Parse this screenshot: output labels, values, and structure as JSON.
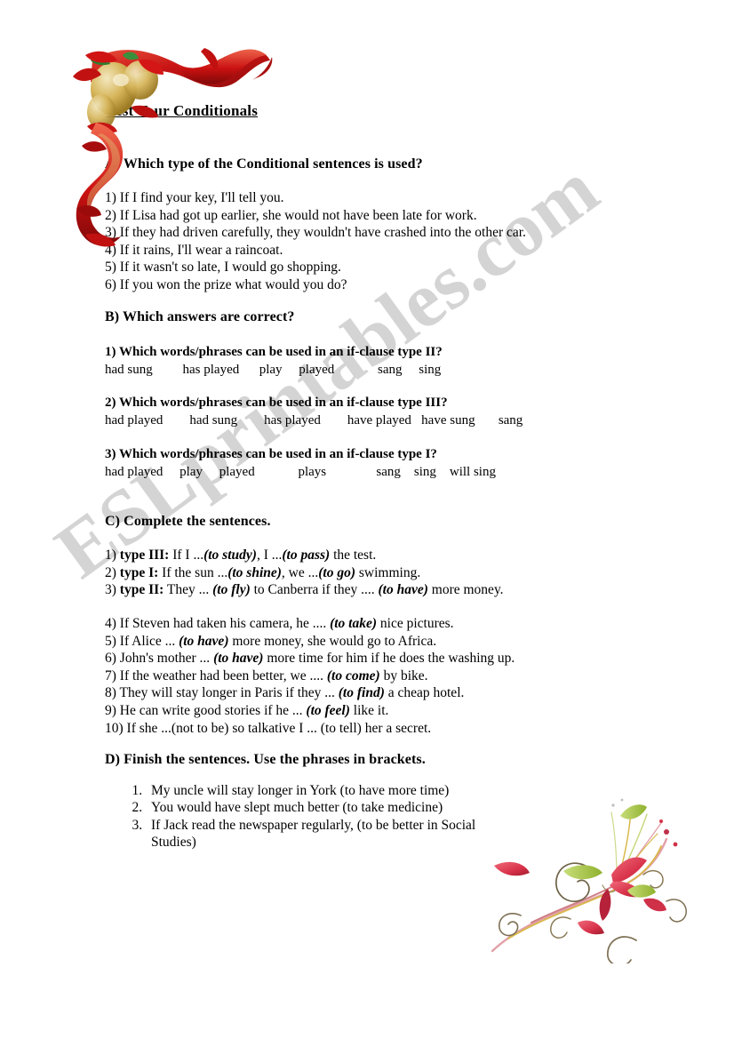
{
  "document": {
    "title": "Test Your Conditionals",
    "watermark": "ESLprintables.com",
    "watermark_color": "#d2d2d2",
    "page_background": "#ffffff",
    "text_color": "#000000"
  },
  "decorations": {
    "top_left": {
      "name": "red-ribbon-corner",
      "description": "Red ribbon corner swirl with gold bells",
      "colors": {
        "ribbon": "#cc1111",
        "ribbon_dark": "#8f0b0b",
        "ribbon_light": "#e8503c",
        "gold": "#c9a227",
        "gold_light": "#e8d79a",
        "leaf": "#2f7d32"
      }
    },
    "bottom_right": {
      "name": "floral-swirl",
      "description": "Floral swirl flourish with red petals and green leaves",
      "colors": {
        "petal": "#d8324a",
        "petal_light": "#ef6a7a",
        "leaf": "#9fc23c",
        "stem": "#d9b84a",
        "tendril": "#8a7a55"
      }
    }
  },
  "sections": {
    "a": {
      "heading": "A) Which type of the Conditional sentences is used?",
      "items": [
        "1) If I find your key, I'll tell you.",
        "2) If Lisa had got up earlier, she would not have been late for work.",
        "3) If they had driven carefully, they wouldn't have crashed into the other car.",
        "4) If it rains, I'll wear a raincoat.",
        "5) If it wasn't so late, I would go shopping.",
        "6) If you won the prize what would you do?"
      ]
    },
    "b": {
      "heading": "B) Which answers are correct?",
      "questions": [
        {
          "prompt": "1) Which words/phrases can be used in an if-clause type II?",
          "options_line": "had sung         has played      play     played             sang     sing",
          "options": [
            "had sung",
            "has played",
            "play",
            "played",
            "sang",
            "sing"
          ]
        },
        {
          "prompt": "2) Which words/phrases can be used in an if-clause type III?",
          "options_line": "had played        had sung        has played        have played   have sung       sang",
          "options": [
            "had played",
            "had sung",
            "has played",
            "have played",
            "have sung",
            "sang"
          ]
        },
        {
          "prompt": "3) Which words/phrases can be used in an if-clause type I?",
          "options_line": "had played     play     played             plays               sang    sing    will sing",
          "options": [
            "had played",
            "play",
            "played",
            "plays",
            "sang",
            "sing",
            "will sing"
          ]
        }
      ]
    },
    "c": {
      "heading": "C) Complete the sentences.",
      "group1": [
        {
          "number": "1)",
          "type_label": "type III:",
          "pre": " If I ...",
          "cue1": "(to study)",
          "mid": ", I ...",
          "cue2": "(to pass)",
          "post": " the test."
        },
        {
          "number": "2)",
          "type_label": "type I:",
          "pre": " If the sun ...",
          "cue1": "(to shine)",
          "mid": ", we ...",
          "cue2": "(to go)",
          "post": " swimming."
        },
        {
          "number": " 3)",
          "type_label": "type II:",
          "pre": " They ... ",
          "cue1": "(to fly)",
          "mid": " to Canberra if they .... ",
          "cue2": "(to have)",
          "post": " more money."
        }
      ],
      "group2": [
        {
          "number": "4)",
          "pre": " If Steven had taken his camera, he .... ",
          "cue": "(to take)",
          "post": " nice pictures."
        },
        {
          "number": "5)",
          "pre": " If Alice ... ",
          "cue": "(to have)",
          "post": " more money, she would go to Africa."
        },
        {
          "number": "6)",
          "pre": " John's mother ... ",
          "cue": "(to have)",
          "post": " more time for him if he does the washing up."
        },
        {
          "number": "7)",
          "pre": " If the weather had been better, we .... ",
          "cue": "(to come)",
          "post": " by bike."
        },
        {
          "number": "8)",
          "pre": " They will stay longer in Paris if they ... ",
          "cue": "(to find)",
          "post": " a cheap hotel."
        },
        {
          "number": "9)",
          "pre": " He can write good stories if he ... ",
          "cue": "(to feel)",
          "post": " like it."
        },
        {
          "number": "10)",
          "pre": " If she ...(not to be) so talkative I ... (to tell) her a secret.",
          "cue": "",
          "post": ""
        }
      ]
    },
    "d": {
      "heading": "D) Finish the sentences. Use the phrases in brackets.",
      "items": [
        "My uncle will stay longer in York (to have more time)",
        "You would have slept much better (to take medicine)",
        "If Jack read the newspaper regularly,  (to be better in Social Studies)"
      ]
    }
  }
}
